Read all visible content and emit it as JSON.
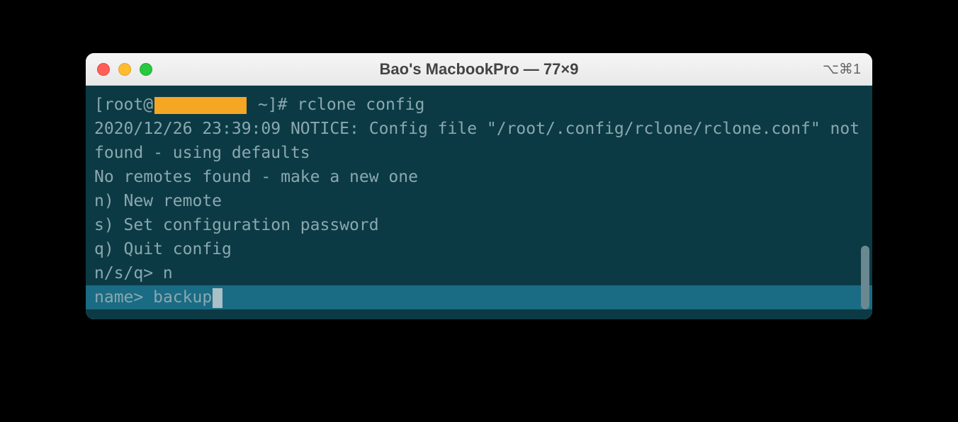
{
  "window": {
    "title": "Bao's MacbookPro — 77×9",
    "shortcut": "⌥⌘1"
  },
  "terminal": {
    "prompt_prefix": "[root@",
    "prompt_suffix": " ~]# ",
    "command": "rclone config",
    "lines": [
      "2020/12/26 23:39:09 NOTICE: Config file \"/root/.config/rclone/rclone.conf\" not found - using defaults",
      "No remotes found - make a new one",
      "n) New remote",
      "s) Set configuration password",
      "q) Quit config",
      "n/s/q> n"
    ],
    "active_prompt": "name> ",
    "active_input": "backup"
  }
}
